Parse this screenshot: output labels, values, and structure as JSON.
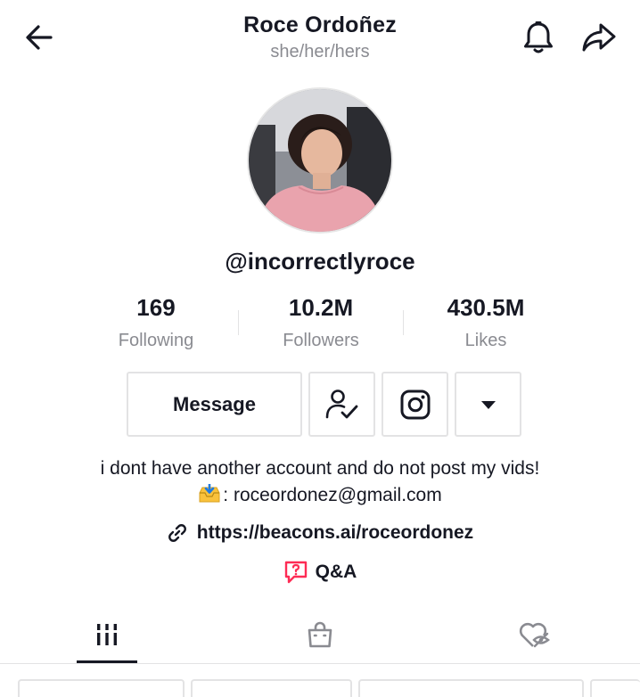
{
  "header": {
    "name": "Roce Ordoñez",
    "pronouns": "she/her/hers",
    "back_icon": "arrow-left-icon",
    "bell_icon": "bell-icon",
    "share_icon": "share-icon"
  },
  "profile": {
    "handle": "@incorrectlyroce",
    "stats": [
      {
        "value": "169",
        "label": "Following"
      },
      {
        "value": "10.2M",
        "label": "Followers"
      },
      {
        "value": "430.5M",
        "label": "Likes"
      }
    ],
    "message_label": "Message",
    "bio_line1": "i dont have another account and do not post my vids!",
    "bio_line2": ": roceordonez@gmail.com",
    "link": "https://beacons.ai/roceordonez",
    "qa_label": "Q&A"
  },
  "tabs": [
    {
      "icon": "grid-icon",
      "active": true
    },
    {
      "icon": "shopping-bag-icon",
      "active": false
    },
    {
      "icon": "liked-hidden-icon",
      "active": false
    }
  ],
  "colors": {
    "text": "#161823",
    "muted": "#8a8b91",
    "border": "#e3e3e4",
    "accent": "#fe2c55"
  }
}
